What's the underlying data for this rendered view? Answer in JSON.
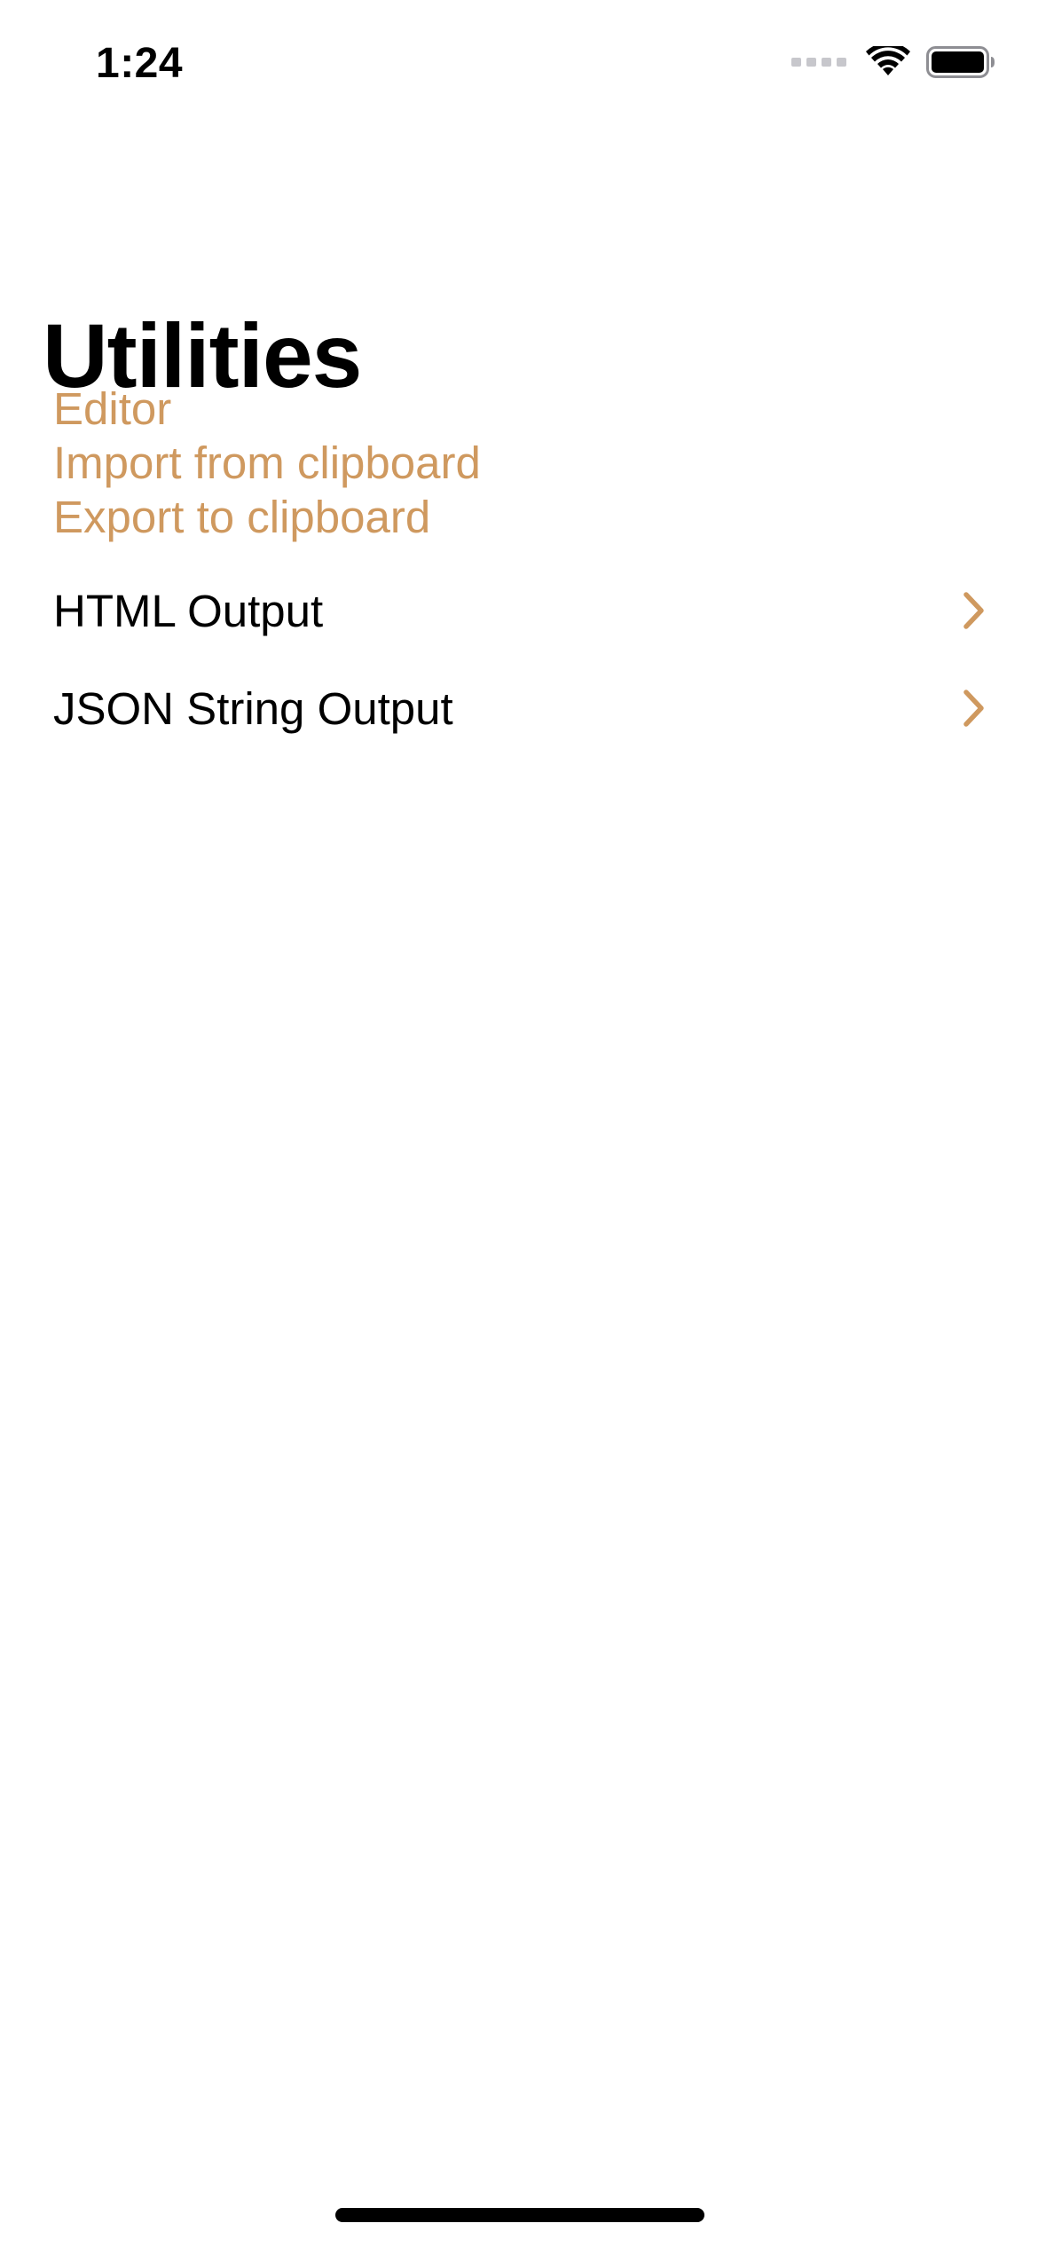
{
  "status_bar": {
    "time": "1:24",
    "icons": [
      "cellular-signal-icon",
      "wifi-icon",
      "battery-icon"
    ]
  },
  "header": {
    "title": "Utilities"
  },
  "actions": [
    {
      "label": "Editor"
    },
    {
      "label": "Import from clipboard"
    },
    {
      "label": "Export to clipboard"
    }
  ],
  "nav_items": [
    {
      "label": "HTML Output",
      "icon": "chevron-right-icon"
    },
    {
      "label": "JSON String Output",
      "icon": "chevron-right-icon"
    }
  ],
  "colors": {
    "accent": "#CF995F",
    "text": "#000000",
    "background": "#FFFFFF"
  }
}
